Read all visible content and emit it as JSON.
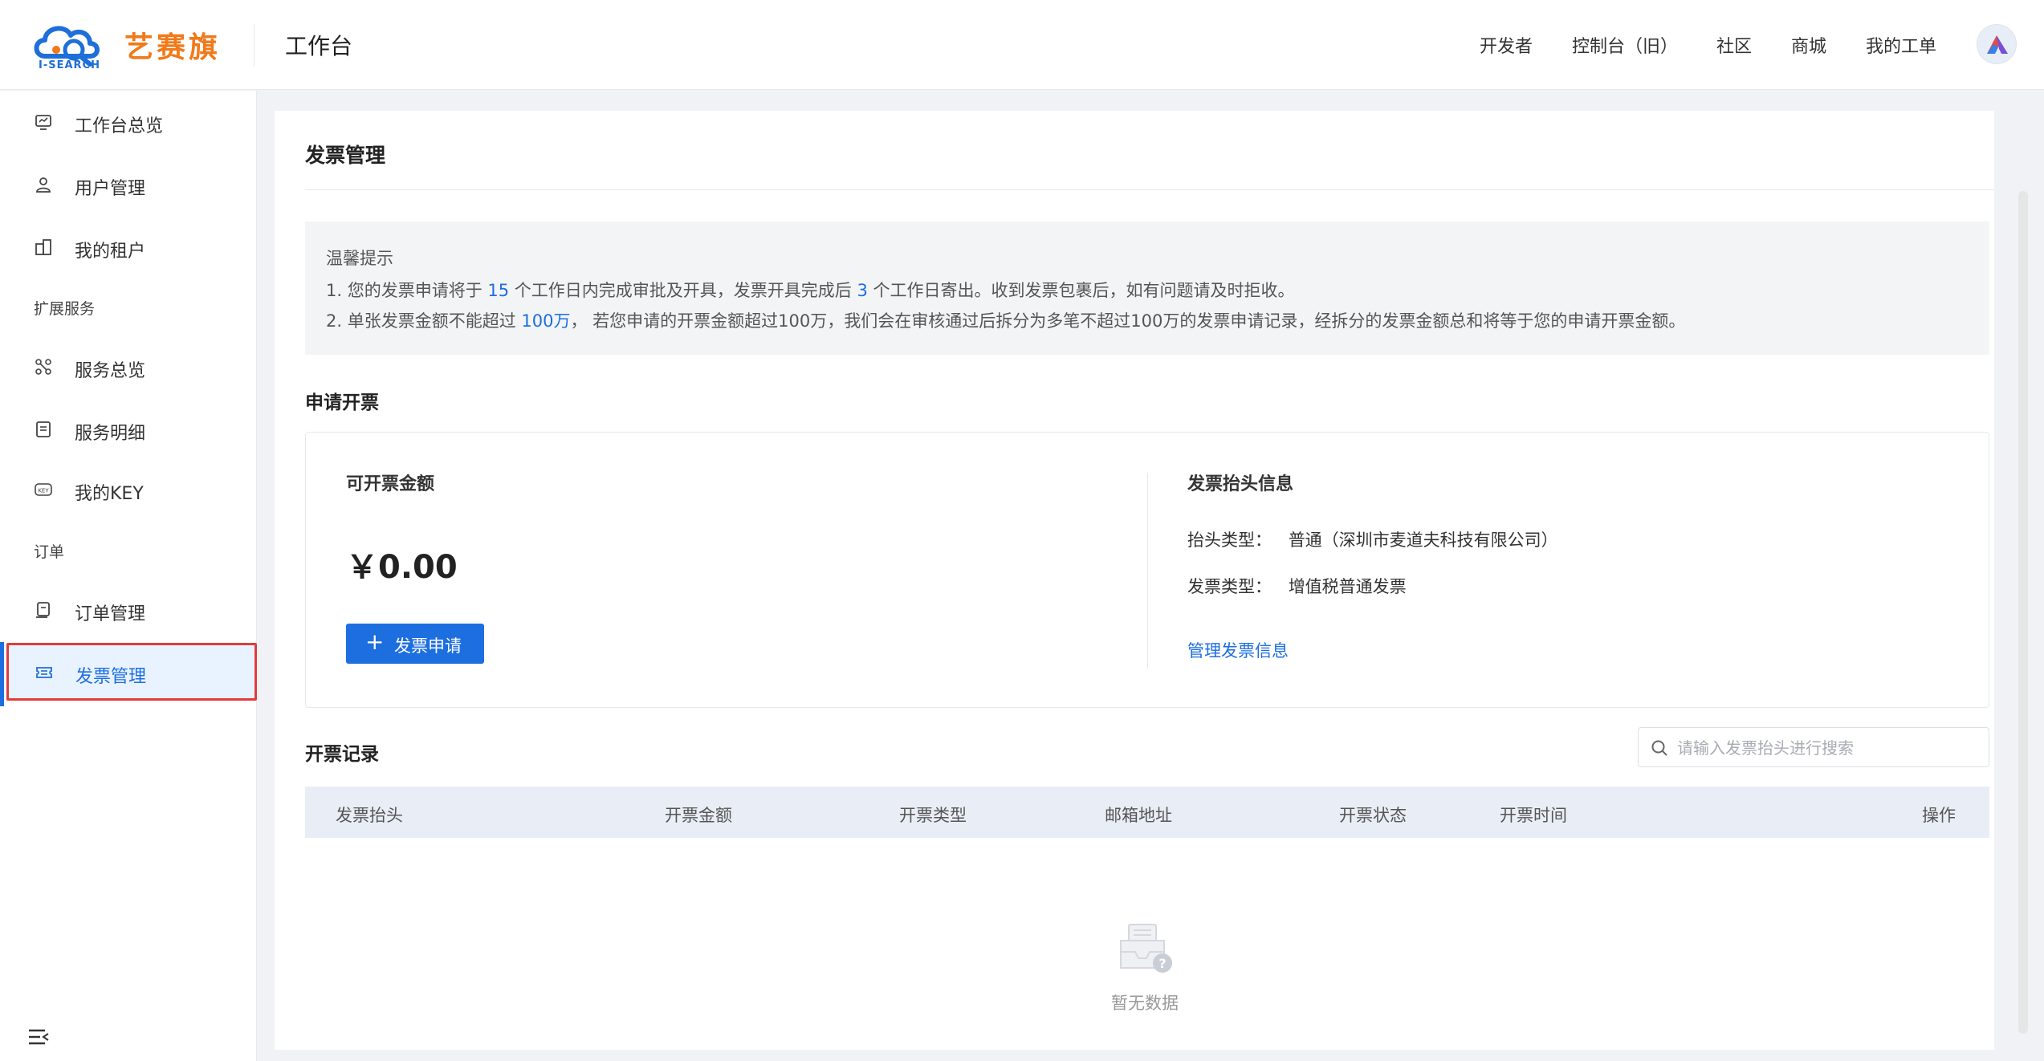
{
  "header": {
    "logo_text": "艺赛旗",
    "logo_sub": "I-SEARCH",
    "title": "工作台",
    "nav": [
      "开发者",
      "控制台（旧）",
      "社区",
      "商城",
      "我的工单"
    ]
  },
  "sidebar": {
    "items": [
      {
        "label": "工作台总览",
        "icon": "dashboard-icon"
      },
      {
        "label": "用户管理",
        "icon": "user-icon"
      },
      {
        "label": "我的租户",
        "icon": "building-icon"
      }
    ],
    "group_ext": "扩展服务",
    "ext_items": [
      {
        "label": "服务总览",
        "icon": "services-icon"
      },
      {
        "label": "服务明细",
        "icon": "list-icon"
      },
      {
        "label": "我的KEY",
        "icon": "key-icon"
      }
    ],
    "group_order": "订单",
    "order_items": [
      {
        "label": "订单管理",
        "icon": "order-icon"
      },
      {
        "label": "发票管理",
        "icon": "invoice-icon"
      }
    ]
  },
  "main": {
    "page_title": "发票管理",
    "tips": {
      "title": "温馨提示",
      "line1": {
        "a": "1. 您的发票申请将于 ",
        "n1": "15",
        "b": " 个工作日内完成审批及开具，发票开具完成后 ",
        "n2": "3",
        "c": " 个工作日寄出。收到发票包裹后，如有问题请及时拒收。"
      },
      "line2": {
        "a": "2. 单张发票金额不能超过 ",
        "n1": "100万",
        "b": "， 若您申请的开票金额超过100万，我们会在审核通过后拆分为多笔不超过100万的发票申请记录，经拆分的发票金额总和将等于您的申请开票金额。"
      }
    },
    "apply": {
      "section_title": "申请开票",
      "amount_label": "可开票金额",
      "amount": "￥0.00",
      "button_label": "发票申请",
      "header_info_title": "发票抬头信息",
      "rows": [
        {
          "k": "抬头类型：",
          "v": "普通（深圳市麦道夫科技有限公司）"
        },
        {
          "k": "发票类型：",
          "v": "增值税普通发票"
        }
      ],
      "manage_link": "管理发票信息"
    },
    "records": {
      "section_title": "开票记录",
      "search_placeholder": "请输入发票抬头进行搜索",
      "columns": [
        "发票抬头",
        "开票金额",
        "开票类型",
        "邮箱地址",
        "开票状态",
        "开票时间",
        "操作"
      ],
      "empty_text": "暂无数据"
    }
  },
  "colors": {
    "primary": "#1d6fe0",
    "brand_orange": "#f07a1a",
    "highlight_border": "#e23b3b"
  }
}
